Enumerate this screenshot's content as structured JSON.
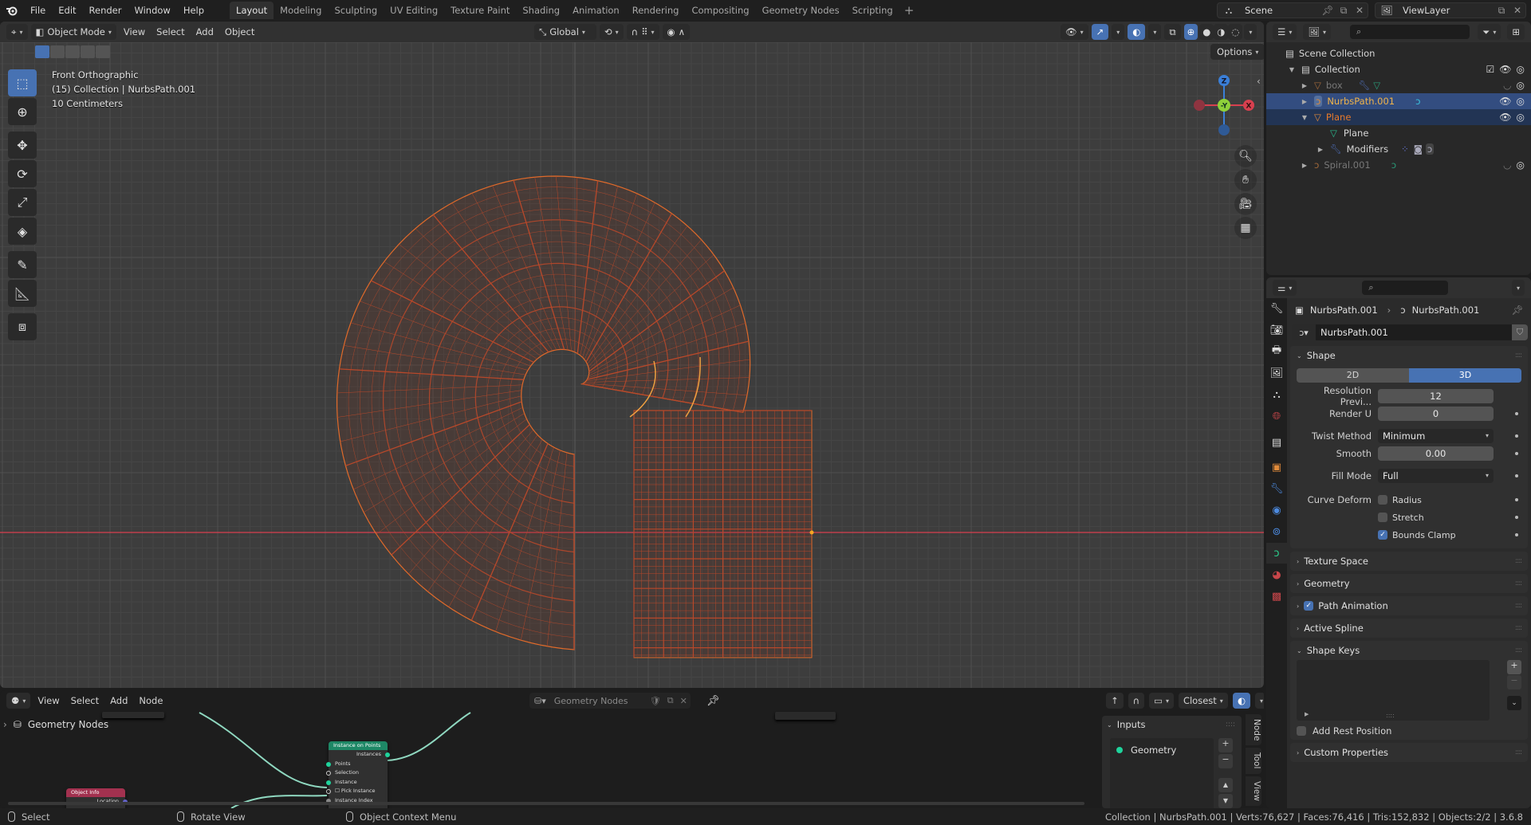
{
  "topbar": {
    "menus": [
      "File",
      "Edit",
      "Render",
      "Window",
      "Help"
    ],
    "workspaces": [
      "Layout",
      "Modeling",
      "Sculpting",
      "UV Editing",
      "Texture Paint",
      "Shading",
      "Animation",
      "Rendering",
      "Compositing",
      "Geometry Nodes",
      "Scripting"
    ],
    "active_workspace": "Layout",
    "add_workspace": "+",
    "scene": "Scene",
    "view_layer": "ViewLayer"
  },
  "viewport": {
    "mode": "Object Mode",
    "menus": [
      "View",
      "Select",
      "Add",
      "Object"
    ],
    "transform_orientation": "Global",
    "options_label": "Options",
    "overlay_lines": [
      "Front Orthographic",
      "(15) Collection | NurbsPath.001",
      "10 Centimeters"
    ],
    "gizmo_axes": {
      "z": "Z",
      "y": "-Y",
      "x": "X"
    },
    "colors": {
      "wire": "#b8482a",
      "wire_bright": "#e06a2a",
      "bg": "#3d3d3d",
      "x_axis": "#d8404f",
      "y_axis": "#8ed13a",
      "z_axis": "#3a7fd8"
    }
  },
  "node_editor": {
    "menus": [
      "View",
      "Select",
      "Add",
      "Node"
    ],
    "tree_name": "Geometry Nodes",
    "breadcrumb": "Geometry Nodes",
    "snap_mode": "Closest",
    "nodes": {
      "instance_on_points": {
        "title": "Instance on Points",
        "outputs": [
          "Instances"
        ],
        "inputs": [
          "Points",
          "Selection",
          "Instance",
          "Pick Instance",
          "Instance Index"
        ]
      },
      "object_info": {
        "title": "Object Info",
        "outputs": [
          "Location"
        ]
      }
    },
    "sidebar": {
      "panel": "Inputs",
      "items": [
        "Geometry"
      ],
      "tabs": [
        "Node",
        "Tool",
        "View"
      ]
    }
  },
  "outliner": {
    "root": "Scene Collection",
    "rows": [
      {
        "name": "Collection",
        "type": "collection"
      },
      {
        "name": "box",
        "type": "mesh",
        "dim": true
      },
      {
        "name": "NurbsPath.001",
        "type": "curve",
        "selected": true
      },
      {
        "name": "Plane",
        "type": "mesh",
        "active_parent": true
      },
      {
        "name": "Plane",
        "type": "mesh-data"
      },
      {
        "name": "Modifiers",
        "type": "modifiers"
      },
      {
        "name": "Spiral.001",
        "type": "curve",
        "dim": true
      }
    ]
  },
  "properties": {
    "breadcrumb_object": "NurbsPath.001",
    "breadcrumb_data": "NurbsPath.001",
    "datablock_name": "NurbsPath.001",
    "shape": {
      "title": "Shape",
      "dim_options": [
        "2D",
        "3D"
      ],
      "dim_selected": "3D",
      "resolution_preview_label": "Resolution Previ...",
      "resolution_preview": "12",
      "render_u_label": "Render U",
      "render_u": "0",
      "twist_method_label": "Twist Method",
      "twist_method": "Minimum",
      "smooth_label": "Smooth",
      "smooth": "0.00",
      "fill_mode_label": "Fill Mode",
      "fill_mode": "Full",
      "curve_deform_label": "Curve Deform",
      "curve_deform": [
        {
          "label": "Radius",
          "checked": false
        },
        {
          "label": "Stretch",
          "checked": false
        },
        {
          "label": "Bounds Clamp",
          "checked": true
        }
      ]
    },
    "collapsed_panels": [
      "Texture Space",
      "Geometry"
    ],
    "path_animation": {
      "label": "Path Animation",
      "checked": true
    },
    "active_spline": "Active Spline",
    "shape_keys": {
      "title": "Shape Keys",
      "add_rest_position": "Add Rest Position",
      "add_rest_checked": false
    },
    "custom_properties": "Custom Properties"
  },
  "statusbar": {
    "select": "Select",
    "rotate": "Rotate View",
    "context_menu": "Object Context Menu",
    "stats": "Collection | NurbsPath.001 | Verts:76,627 | Faces:76,416 | Tris:152,832 | Objects:2/2 | 3.6.8"
  }
}
